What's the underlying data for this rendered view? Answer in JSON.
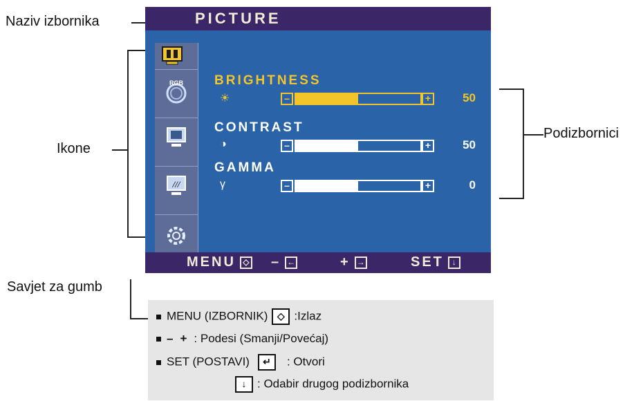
{
  "callouts": {
    "menu_name": "Naziv izbornika",
    "icons": "Ikone",
    "submenus": "Podizbornici",
    "button_tip": "Savjet za gumb"
  },
  "osd": {
    "title": "PICTURE",
    "submenus": [
      {
        "label": "BRIGHTNESS",
        "symbol": "☀",
        "value": "50",
        "level": 0.5,
        "active": true
      },
      {
        "label": "CONTRAST",
        "symbol": "◑",
        "value": "50",
        "level": 0.5,
        "active": false
      },
      {
        "label": "GAMMA",
        "symbol": "γ",
        "value": "0",
        "level": 0.5,
        "active": false
      }
    ],
    "icons": [
      "picture-icon",
      "rgb-color-icon",
      "tracking-icon",
      "setup-icon",
      "select-icon"
    ],
    "icon_rgb_text": "RGB",
    "footer": {
      "menu": "MENU",
      "minus": "–",
      "plus": "+",
      "set": "SET"
    },
    "colors": {
      "background": "#2b63a8",
      "title_bar": "#3b2767",
      "highlight": "#f4c52a",
      "text": "#ffffff"
    }
  },
  "help": {
    "line1_prefix": "MENU (IZBORNIK)",
    "line1_suffix": ":Izlaz",
    "line2_minus": "–",
    "line2_plus": "+",
    "line2_suffix": ": Podesi (Smanji/Povećaj)",
    "line3_prefix": "SET (POSTAVI)",
    "line3_suffix": ": Otvori",
    "line4_suffix": ": Odabir drugog podizbornika"
  }
}
